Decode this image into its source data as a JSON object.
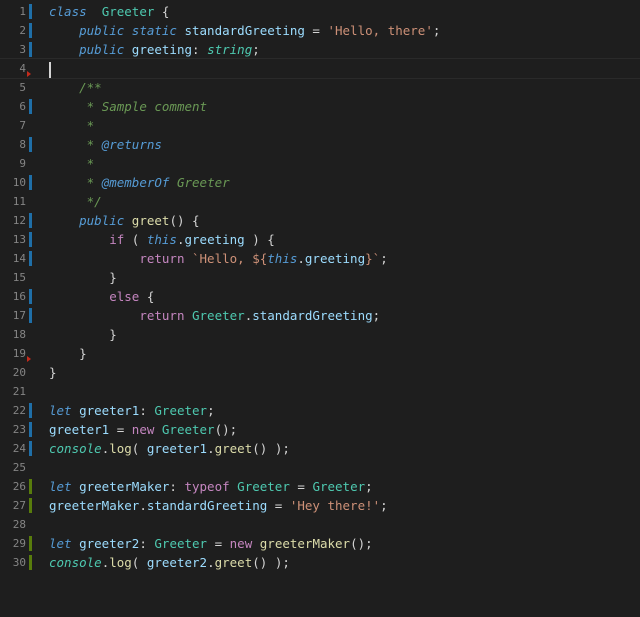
{
  "editor": {
    "language": "typescript",
    "lines": [
      {
        "n": "1",
        "bar": "blue",
        "tokens": [
          [
            "kw",
            "class"
          ],
          [
            "",
            "  "
          ],
          [
            "cls",
            "Greeter"
          ],
          [
            "",
            " {"
          ]
        ]
      },
      {
        "n": "2",
        "bar": "blue",
        "tokens": [
          [
            "",
            "    "
          ],
          [
            "kw",
            "public"
          ],
          [
            "",
            " "
          ],
          [
            "kw",
            "static"
          ],
          [
            "",
            " "
          ],
          [
            "var",
            "standardGreeting"
          ],
          [
            "",
            " = "
          ],
          [
            "str",
            "'Hello, there'"
          ],
          [
            "",
            ";"
          ]
        ]
      },
      {
        "n": "3",
        "bar": "blue",
        "tokens": [
          [
            "",
            "    "
          ],
          [
            "kw",
            "public"
          ],
          [
            "",
            " "
          ],
          [
            "var",
            "greeting"
          ],
          [
            "",
            ": "
          ],
          [
            "typ",
            "string"
          ],
          [
            "",
            ";"
          ]
        ]
      },
      {
        "n": "4",
        "bar": "",
        "current": true,
        "marker": true,
        "tokens": []
      },
      {
        "n": "5",
        "bar": "",
        "tokens": [
          [
            "",
            "    "
          ],
          [
            "cmt",
            "/**"
          ]
        ]
      },
      {
        "n": "6",
        "bar": "blue",
        "tokens": [
          [
            "",
            "     "
          ],
          [
            "cmt",
            "* Sample comment"
          ]
        ]
      },
      {
        "n": "7",
        "bar": "",
        "tokens": [
          [
            "",
            "     "
          ],
          [
            "cmt",
            "*"
          ]
        ]
      },
      {
        "n": "8",
        "bar": "blue",
        "tokens": [
          [
            "",
            "     "
          ],
          [
            "cmt",
            "* "
          ],
          [
            "doc",
            "@returns"
          ]
        ]
      },
      {
        "n": "9",
        "bar": "",
        "tokens": [
          [
            "",
            "     "
          ],
          [
            "cmt",
            "*"
          ]
        ]
      },
      {
        "n": "10",
        "bar": "blue",
        "tokens": [
          [
            "",
            "     "
          ],
          [
            "cmt",
            "* "
          ],
          [
            "doc",
            "@memberOf"
          ],
          [
            "cmt",
            " Greeter"
          ]
        ]
      },
      {
        "n": "11",
        "bar": "",
        "tokens": [
          [
            "",
            "     "
          ],
          [
            "cmt",
            "*/"
          ]
        ]
      },
      {
        "n": "12",
        "bar": "blue",
        "tokens": [
          [
            "",
            "    "
          ],
          [
            "kw",
            "public"
          ],
          [
            "",
            " "
          ],
          [
            "fn",
            "greet"
          ],
          [
            "",
            "() {"
          ]
        ]
      },
      {
        "n": "13",
        "bar": "blue",
        "tokens": [
          [
            "",
            "        "
          ],
          [
            "kw2",
            "if"
          ],
          [
            "",
            " ( "
          ],
          [
            "this",
            "this"
          ],
          [
            "",
            "."
          ],
          [
            "var",
            "greeting"
          ],
          [
            "",
            " ) {"
          ]
        ]
      },
      {
        "n": "14",
        "bar": "blue",
        "tokens": [
          [
            "",
            "            "
          ],
          [
            "kw2",
            "return"
          ],
          [
            "",
            " "
          ],
          [
            "str",
            "`Hello, ${"
          ],
          [
            "this",
            "this"
          ],
          [
            "",
            "."
          ],
          [
            "var",
            "greeting"
          ],
          [
            "str",
            "}`"
          ],
          [
            "",
            ";"
          ]
        ]
      },
      {
        "n": "15",
        "bar": "",
        "tokens": [
          [
            "",
            "        }"
          ]
        ]
      },
      {
        "n": "16",
        "bar": "blue",
        "tokens": [
          [
            "",
            "        "
          ],
          [
            "kw2",
            "else"
          ],
          [
            "",
            " {"
          ]
        ]
      },
      {
        "n": "17",
        "bar": "blue",
        "tokens": [
          [
            "",
            "            "
          ],
          [
            "kw2",
            "return"
          ],
          [
            "",
            " "
          ],
          [
            "cls",
            "Greeter"
          ],
          [
            "",
            "."
          ],
          [
            "var",
            "standardGreeting"
          ],
          [
            "",
            ";"
          ]
        ]
      },
      {
        "n": "18",
        "bar": "",
        "tokens": [
          [
            "",
            "        }"
          ]
        ]
      },
      {
        "n": "19",
        "bar": "",
        "marker": true,
        "tokens": [
          [
            "",
            "    }"
          ]
        ]
      },
      {
        "n": "20",
        "bar": "",
        "tokens": [
          [
            "",
            "}"
          ]
        ]
      },
      {
        "n": "21",
        "bar": "",
        "tokens": []
      },
      {
        "n": "22",
        "bar": "blue",
        "tokens": [
          [
            "kw",
            "let"
          ],
          [
            "",
            " "
          ],
          [
            "var",
            "greeter1"
          ],
          [
            "",
            ": "
          ],
          [
            "cls",
            "Greeter"
          ],
          [
            "",
            ";"
          ]
        ]
      },
      {
        "n": "23",
        "bar": "blue",
        "tokens": [
          [
            "var",
            "greeter1"
          ],
          [
            "",
            " = "
          ],
          [
            "kw2",
            "new"
          ],
          [
            "",
            " "
          ],
          [
            "cls",
            "Greeter"
          ],
          [
            "",
            "();"
          ]
        ]
      },
      {
        "n": "24",
        "bar": "blue",
        "tokens": [
          [
            "typ",
            "console"
          ],
          [
            "",
            "."
          ],
          [
            "fn",
            "log"
          ],
          [
            "",
            "( "
          ],
          [
            "var",
            "greeter1"
          ],
          [
            "",
            "."
          ],
          [
            "fn",
            "greet"
          ],
          [
            "",
            "() );"
          ]
        ]
      },
      {
        "n": "25",
        "bar": "",
        "tokens": []
      },
      {
        "n": "26",
        "bar": "green",
        "tokens": [
          [
            "kw",
            "let"
          ],
          [
            "",
            " "
          ],
          [
            "var",
            "greeterMaker"
          ],
          [
            "",
            ": "
          ],
          [
            "kw2",
            "typeof"
          ],
          [
            "",
            " "
          ],
          [
            "cls",
            "Greeter"
          ],
          [
            "",
            " = "
          ],
          [
            "cls",
            "Greeter"
          ],
          [
            "",
            ";"
          ]
        ]
      },
      {
        "n": "27",
        "bar": "green",
        "tokens": [
          [
            "var",
            "greeterMaker"
          ],
          [
            "",
            "."
          ],
          [
            "var",
            "standardGreeting"
          ],
          [
            "",
            " = "
          ],
          [
            "str",
            "'Hey there!'"
          ],
          [
            "",
            ";"
          ]
        ]
      },
      {
        "n": "28",
        "bar": "",
        "tokens": []
      },
      {
        "n": "29",
        "bar": "green",
        "tokens": [
          [
            "kw",
            "let"
          ],
          [
            "",
            " "
          ],
          [
            "var",
            "greeter2"
          ],
          [
            "",
            ": "
          ],
          [
            "cls",
            "Greeter"
          ],
          [
            "",
            " = "
          ],
          [
            "kw2",
            "new"
          ],
          [
            "",
            " "
          ],
          [
            "fn",
            "greeterMaker"
          ],
          [
            "",
            "();"
          ]
        ]
      },
      {
        "n": "30",
        "bar": "green",
        "tokens": [
          [
            "typ",
            "console"
          ],
          [
            "",
            "."
          ],
          [
            "fn",
            "log"
          ],
          [
            "",
            "( "
          ],
          [
            "var",
            "greeter2"
          ],
          [
            "",
            "."
          ],
          [
            "fn",
            "greet"
          ],
          [
            "",
            "() );"
          ]
        ]
      }
    ]
  }
}
